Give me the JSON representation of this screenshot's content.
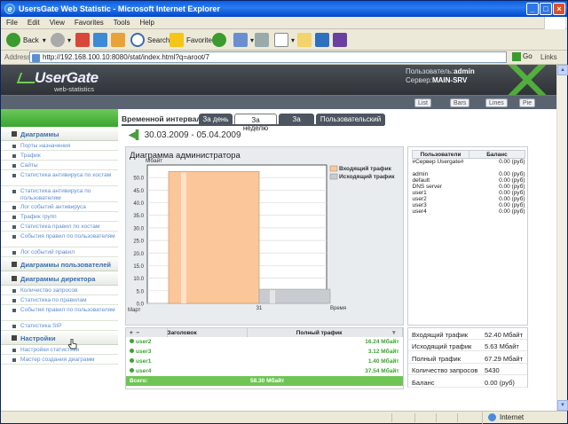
{
  "browser": {
    "title": "UsersGate Web Statistic - Microsoft Internet Explorer",
    "menu": [
      "File",
      "Edit",
      "View",
      "Favorites",
      "Tools",
      "Help"
    ],
    "toolbar": {
      "back": "Back",
      "search": "Search",
      "favorites": "Favorites"
    },
    "address_label": "Address",
    "url": "http://192.168.100.10:8080/stat/index.html?q=aroot/7",
    "go": "Go",
    "links": "Links",
    "status_zone": "Internet"
  },
  "header": {
    "logo_main": "UserGate",
    "logo_sub": "web-statistics",
    "user_label": "Пользователь:",
    "user_value": "admin",
    "server_label": "Сервер:",
    "server_value": "MAIN-SRV",
    "view_buttons": [
      "List",
      "Bars",
      "Lines",
      "Pie"
    ]
  },
  "leftmenu": {
    "sections": [
      {
        "label": "Диаграммы",
        "items": [
          "Порты назначения",
          "Трафик",
          "Сайты",
          "Статистика антивируса по хостам",
          "Статистика антивируса по пользователям",
          "Лог событий антивируса",
          "Трафик групп",
          "Статистика правил по хостам",
          "События правил по пользователям",
          "Лог событий правил"
        ]
      },
      {
        "label": "Диаграммы пользователей",
        "items": []
      },
      {
        "label": "Диаграммы директора",
        "items": [
          "Количество запросов",
          "Статистика по правилам",
          "События правил по пользователям",
          "Статистика SIP"
        ]
      },
      {
        "label": "Настройки",
        "items": [
          "Настройки статистики",
          "Мастер создания диаграмм"
        ]
      }
    ]
  },
  "interval": {
    "label": "Временной интервал:",
    "tabs": [
      "За день",
      "За неделю",
      "За месяц",
      "Пользовательский"
    ],
    "active": 1,
    "range": "30.03.2009 - 05.04.2009"
  },
  "chart_data": {
    "type": "bar",
    "title": "Диаграмма администратора",
    "ylabel": "Мбайт",
    "xlabel": "Время",
    "x_start_label": "Март",
    "categories": [
      "31"
    ],
    "series": [
      {
        "name": "Входящий трафик",
        "values": [
          52.4
        ],
        "color": "#fbc79a"
      },
      {
        "name": "Исходящий трафик",
        "values": [
          5.63
        ],
        "color": "#c8ccd0"
      }
    ],
    "ylim": [
      0,
      55
    ],
    "yticks": [
      "0.0",
      "5.0",
      "10.0",
      "15.0",
      "20.0",
      "25.0",
      "30.0",
      "35.0",
      "40.0",
      "45.0",
      "50.0"
    ],
    "legend": "top-right"
  },
  "users_table": {
    "headers": [
      "Пользователи",
      "Баланс"
    ],
    "rows": [
      [
        "#Сервер Usergate#",
        "0.00 (руб)"
      ],
      [
        "admin",
        "0.00 (руб)"
      ],
      [
        "default",
        "0.00 (руб)"
      ],
      [
        "DNS server",
        "0.00 (руб)"
      ],
      [
        "user1",
        "0.00 (руб)"
      ],
      [
        "user2",
        "0.00 (руб)"
      ],
      [
        "user3",
        "0.00 (руб)"
      ],
      [
        "user4",
        "0.00 (руб)"
      ]
    ]
  },
  "traffic_table": {
    "controls": [
      "+",
      "−"
    ],
    "headers": [
      "Заголовок",
      "Полный трафик"
    ],
    "rows": [
      [
        "user2",
        "16.24 Мбайт"
      ],
      [
        "user3",
        "3.12 Мбайт"
      ],
      [
        "user1",
        "1.40 Мбайт"
      ],
      [
        "user4",
        "37.54 Мбайт"
      ]
    ],
    "total_label": "Всего:",
    "total_value": "58.30 Мбайт"
  },
  "summary": [
    [
      "Входящий трафик",
      "52.40 Мбайт"
    ],
    [
      "Исходящий трафик",
      "5.63 Мбайт"
    ],
    [
      "Полный трафик",
      "67.29 Мбайт"
    ],
    [
      "Количество запросов",
      "5430"
    ],
    [
      "Баланс",
      "0.00 (руб)"
    ]
  ]
}
